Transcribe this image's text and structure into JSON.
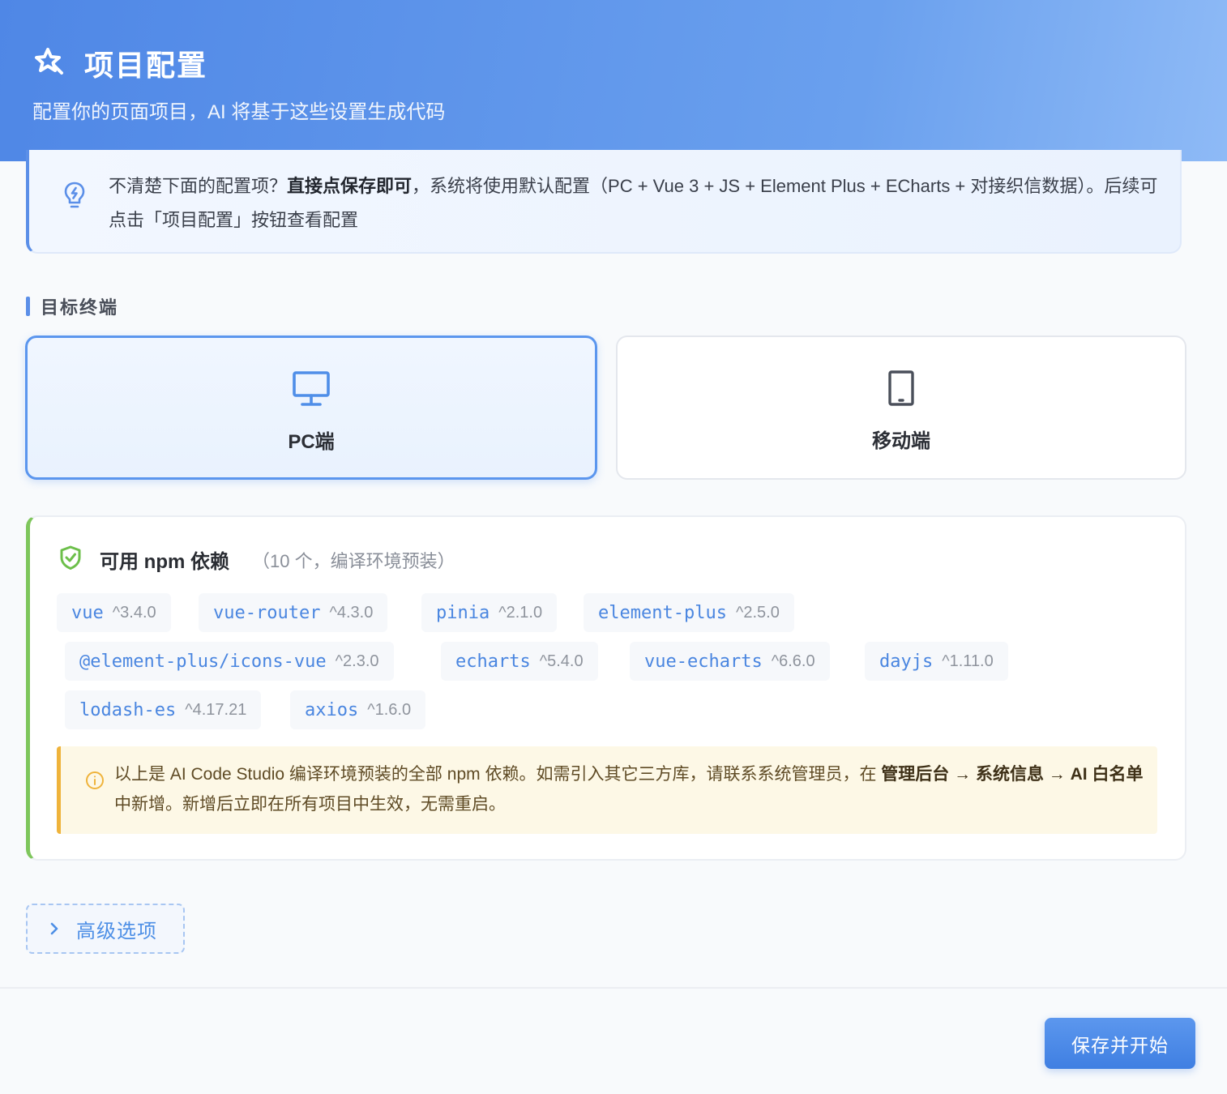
{
  "header": {
    "title": "项目配置",
    "subtitle": "配置你的页面项目，AI 将基于这些设置生成代码",
    "icon": "magic-sparkle-icon"
  },
  "tip": {
    "icon": "lightbulb-icon",
    "text_before": "不清楚下面的配置项？",
    "text_bold": "直接点保存即可",
    "text_after": "，系统将使用默认配置（PC + Vue 3 + JS + Element Plus + ECharts + 对接织信数据）。后续可点击「项目配置」按钮查看配置"
  },
  "target_section": {
    "title": "目标终端",
    "options": [
      {
        "label": "PC端",
        "icon": "monitor-icon",
        "selected": true
      },
      {
        "label": "移动端",
        "icon": "mobile-phone-icon",
        "selected": false
      }
    ]
  },
  "npm_section": {
    "icon": "shield-check-icon",
    "title": "可用 npm 依赖",
    "count_note": "（10 个，编译环境预装）",
    "packages": [
      {
        "name": "vue",
        "version": "^3.4.0"
      },
      {
        "name": "vue-router",
        "version": "^4.3.0"
      },
      {
        "name": "pinia",
        "version": "^2.1.0"
      },
      {
        "name": "element-plus",
        "version": "^2.5.0"
      },
      {
        "name": "@element-plus/icons-vue",
        "version": "^2.3.0"
      },
      {
        "name": "echarts",
        "version": "^5.4.0"
      },
      {
        "name": "vue-echarts",
        "version": "^6.6.0"
      },
      {
        "name": "dayjs",
        "version": "^1.11.0"
      },
      {
        "name": "lodash-es",
        "version": "^4.17.21"
      },
      {
        "name": "axios",
        "version": "^1.6.0"
      }
    ],
    "notice": {
      "icon": "info-circle-icon",
      "part1": "以上是 AI Code Studio 编译环境预装的全部 npm 依赖。如需引入其它三方库，请联系系统管理员，在 ",
      "bold1": "管理后台 → 系统信息 → AI 白名单",
      "part2": " 中新增。新增后立即在所有项目中生效，无需重启。"
    }
  },
  "advanced": {
    "icon": "chevron-right-icon",
    "label": "高级选项"
  },
  "footer": {
    "save_label": "保存并开始"
  },
  "colors": {
    "primary": "#5b8fe8",
    "success": "#7ec65c",
    "warning": "#efb33b"
  }
}
